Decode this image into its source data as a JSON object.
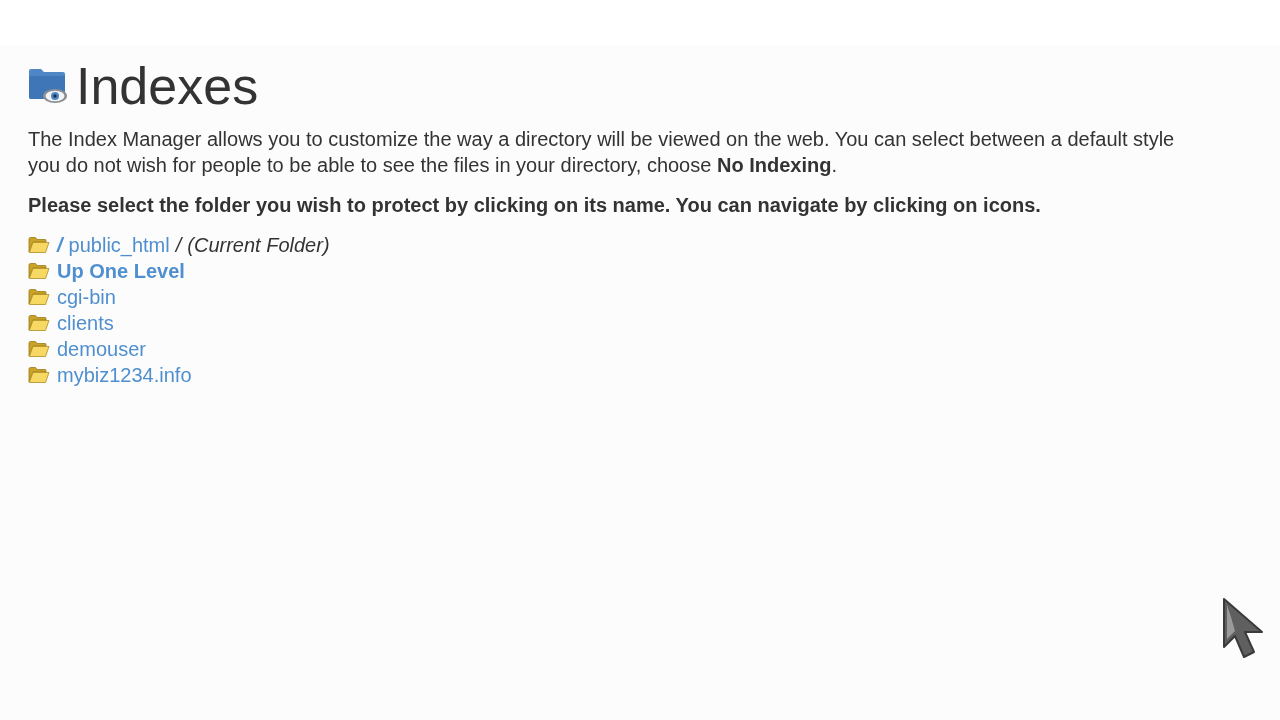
{
  "page": {
    "title": "Indexes"
  },
  "description": {
    "lines": [
      "The Index Manager allows you to customize the way a directory will be viewed on the web. You can select between a default style",
      "you do not wish for people to be able to see the files in your directory, choose **No Indexing**."
    ]
  },
  "instruction": "Please select the folder you wish to protect by clicking on its name. You can navigate by clicking on icons.",
  "folders": [
    {
      "kind": "current",
      "root": "/",
      "name": "public_html",
      "separator": "/",
      "note": "(Current Folder)"
    },
    {
      "kind": "up",
      "name": "Up One Level"
    },
    {
      "kind": "folder",
      "name": "cgi-bin"
    },
    {
      "kind": "folder",
      "name": "clients"
    },
    {
      "kind": "folder",
      "name": "demouser"
    },
    {
      "kind": "folder",
      "name": "mybiz1234.info"
    }
  ]
}
